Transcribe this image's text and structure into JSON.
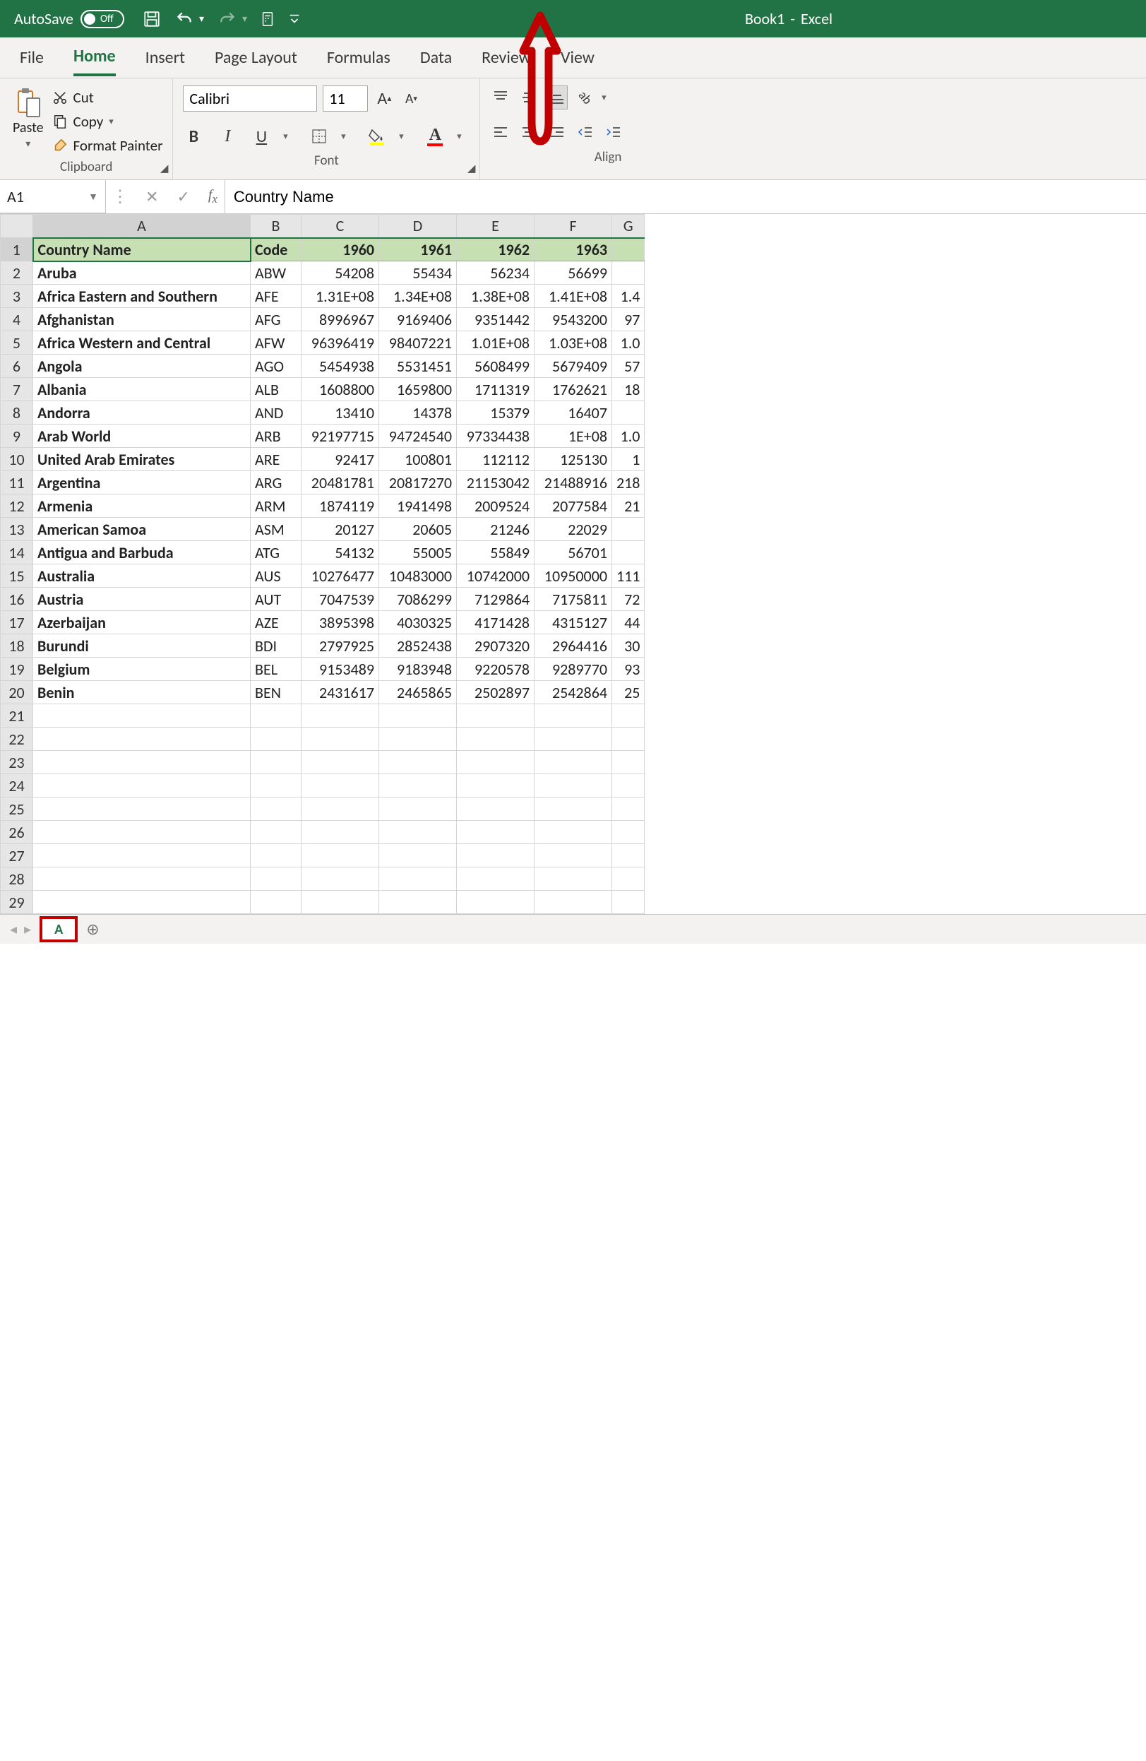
{
  "title": {
    "autosave_label": "AutoSave",
    "autosave_state": "Off",
    "doc": "Book1",
    "sep": "-",
    "app": "Excel"
  },
  "tabs": [
    "File",
    "Home",
    "Insert",
    "Page Layout",
    "Formulas",
    "Data",
    "Review",
    "View"
  ],
  "active_tab": "Home",
  "clipboard": {
    "paste": "Paste",
    "cut": "Cut",
    "copy": "Copy",
    "fp": "Format Painter",
    "label": "Clipboard"
  },
  "font": {
    "name": "Calibri",
    "size": "11",
    "label": "Font"
  },
  "align": {
    "label": "Alignment"
  },
  "name_box": "A1",
  "formula_value": "Country Name",
  "columns": [
    "A",
    "B",
    "C",
    "D",
    "E",
    "F",
    "G"
  ],
  "header_row": [
    "Country Name",
    "Code",
    "1960",
    "1961",
    "1962",
    "1963",
    ""
  ],
  "rows": [
    [
      "Aruba",
      "ABW",
      "54208",
      "55434",
      "56234",
      "56699",
      ""
    ],
    [
      "Africa Eastern and Southern",
      "AFE",
      "1.31E+08",
      "1.34E+08",
      "1.38E+08",
      "1.41E+08",
      "1.4"
    ],
    [
      "Afghanistan",
      "AFG",
      "8996967",
      "9169406",
      "9351442",
      "9543200",
      "97"
    ],
    [
      "Africa Western and Central",
      "AFW",
      "96396419",
      "98407221",
      "1.01E+08",
      "1.03E+08",
      "1.0"
    ],
    [
      "Angola",
      "AGO",
      "5454938",
      "5531451",
      "5608499",
      "5679409",
      "57"
    ],
    [
      "Albania",
      "ALB",
      "1608800",
      "1659800",
      "1711319",
      "1762621",
      "18"
    ],
    [
      "Andorra",
      "AND",
      "13410",
      "14378",
      "15379",
      "16407",
      ""
    ],
    [
      "Arab World",
      "ARB",
      "92197715",
      "94724540",
      "97334438",
      "1E+08",
      "1.0"
    ],
    [
      "United Arab Emirates",
      "ARE",
      "92417",
      "100801",
      "112112",
      "125130",
      "1"
    ],
    [
      "Argentina",
      "ARG",
      "20481781",
      "20817270",
      "21153042",
      "21488916",
      "218"
    ],
    [
      "Armenia",
      "ARM",
      "1874119",
      "1941498",
      "2009524",
      "2077584",
      "21"
    ],
    [
      "American Samoa",
      "ASM",
      "20127",
      "20605",
      "21246",
      "22029",
      ""
    ],
    [
      "Antigua and Barbuda",
      "ATG",
      "54132",
      "55005",
      "55849",
      "56701",
      ""
    ],
    [
      "Australia",
      "AUS",
      "10276477",
      "10483000",
      "10742000",
      "10950000",
      "111"
    ],
    [
      "Austria",
      "AUT",
      "7047539",
      "7086299",
      "7129864",
      "7175811",
      "72"
    ],
    [
      "Azerbaijan",
      "AZE",
      "3895398",
      "4030325",
      "4171428",
      "4315127",
      "44"
    ],
    [
      "Burundi",
      "BDI",
      "2797925",
      "2852438",
      "2907320",
      "2964416",
      "30"
    ],
    [
      "Belgium",
      "BEL",
      "9153489",
      "9183948",
      "9220578",
      "9289770",
      "93"
    ],
    [
      "Benin",
      "BEN",
      "2431617",
      "2465865",
      "2502897",
      "2542864",
      "25"
    ]
  ],
  "empty_rows": 9,
  "sheet_tab": "A",
  "annotation_arrow_color": "#c00000"
}
